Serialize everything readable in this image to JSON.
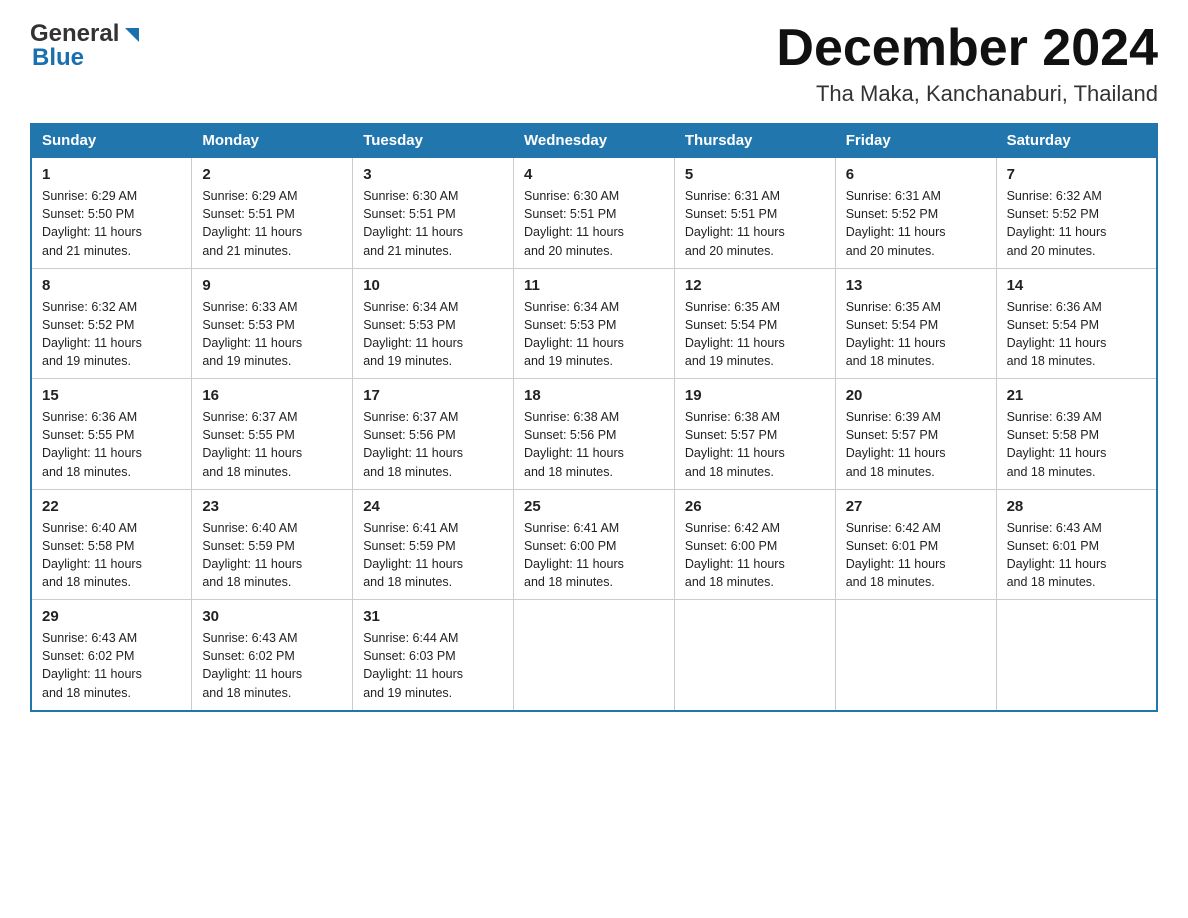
{
  "header": {
    "logo_general": "General",
    "logo_blue": "Blue",
    "main_title": "December 2024",
    "sub_title": "Tha Maka, Kanchanaburi, Thailand"
  },
  "days_of_week": [
    "Sunday",
    "Monday",
    "Tuesday",
    "Wednesday",
    "Thursday",
    "Friday",
    "Saturday"
  ],
  "weeks": [
    [
      {
        "day": "1",
        "sunrise": "6:29 AM",
        "sunset": "5:50 PM",
        "daylight": "11 hours and 21 minutes."
      },
      {
        "day": "2",
        "sunrise": "6:29 AM",
        "sunset": "5:51 PM",
        "daylight": "11 hours and 21 minutes."
      },
      {
        "day": "3",
        "sunrise": "6:30 AM",
        "sunset": "5:51 PM",
        "daylight": "11 hours and 21 minutes."
      },
      {
        "day": "4",
        "sunrise": "6:30 AM",
        "sunset": "5:51 PM",
        "daylight": "11 hours and 20 minutes."
      },
      {
        "day": "5",
        "sunrise": "6:31 AM",
        "sunset": "5:51 PM",
        "daylight": "11 hours and 20 minutes."
      },
      {
        "day": "6",
        "sunrise": "6:31 AM",
        "sunset": "5:52 PM",
        "daylight": "11 hours and 20 minutes."
      },
      {
        "day": "7",
        "sunrise": "6:32 AM",
        "sunset": "5:52 PM",
        "daylight": "11 hours and 20 minutes."
      }
    ],
    [
      {
        "day": "8",
        "sunrise": "6:32 AM",
        "sunset": "5:52 PM",
        "daylight": "11 hours and 19 minutes."
      },
      {
        "day": "9",
        "sunrise": "6:33 AM",
        "sunset": "5:53 PM",
        "daylight": "11 hours and 19 minutes."
      },
      {
        "day": "10",
        "sunrise": "6:34 AM",
        "sunset": "5:53 PM",
        "daylight": "11 hours and 19 minutes."
      },
      {
        "day": "11",
        "sunrise": "6:34 AM",
        "sunset": "5:53 PM",
        "daylight": "11 hours and 19 minutes."
      },
      {
        "day": "12",
        "sunrise": "6:35 AM",
        "sunset": "5:54 PM",
        "daylight": "11 hours and 19 minutes."
      },
      {
        "day": "13",
        "sunrise": "6:35 AM",
        "sunset": "5:54 PM",
        "daylight": "11 hours and 18 minutes."
      },
      {
        "day": "14",
        "sunrise": "6:36 AM",
        "sunset": "5:54 PM",
        "daylight": "11 hours and 18 minutes."
      }
    ],
    [
      {
        "day": "15",
        "sunrise": "6:36 AM",
        "sunset": "5:55 PM",
        "daylight": "11 hours and 18 minutes."
      },
      {
        "day": "16",
        "sunrise": "6:37 AM",
        "sunset": "5:55 PM",
        "daylight": "11 hours and 18 minutes."
      },
      {
        "day": "17",
        "sunrise": "6:37 AM",
        "sunset": "5:56 PM",
        "daylight": "11 hours and 18 minutes."
      },
      {
        "day": "18",
        "sunrise": "6:38 AM",
        "sunset": "5:56 PM",
        "daylight": "11 hours and 18 minutes."
      },
      {
        "day": "19",
        "sunrise": "6:38 AM",
        "sunset": "5:57 PM",
        "daylight": "11 hours and 18 minutes."
      },
      {
        "day": "20",
        "sunrise": "6:39 AM",
        "sunset": "5:57 PM",
        "daylight": "11 hours and 18 minutes."
      },
      {
        "day": "21",
        "sunrise": "6:39 AM",
        "sunset": "5:58 PM",
        "daylight": "11 hours and 18 minutes."
      }
    ],
    [
      {
        "day": "22",
        "sunrise": "6:40 AM",
        "sunset": "5:58 PM",
        "daylight": "11 hours and 18 minutes."
      },
      {
        "day": "23",
        "sunrise": "6:40 AM",
        "sunset": "5:59 PM",
        "daylight": "11 hours and 18 minutes."
      },
      {
        "day": "24",
        "sunrise": "6:41 AM",
        "sunset": "5:59 PM",
        "daylight": "11 hours and 18 minutes."
      },
      {
        "day": "25",
        "sunrise": "6:41 AM",
        "sunset": "6:00 PM",
        "daylight": "11 hours and 18 minutes."
      },
      {
        "day": "26",
        "sunrise": "6:42 AM",
        "sunset": "6:00 PM",
        "daylight": "11 hours and 18 minutes."
      },
      {
        "day": "27",
        "sunrise": "6:42 AM",
        "sunset": "6:01 PM",
        "daylight": "11 hours and 18 minutes."
      },
      {
        "day": "28",
        "sunrise": "6:43 AM",
        "sunset": "6:01 PM",
        "daylight": "11 hours and 18 minutes."
      }
    ],
    [
      {
        "day": "29",
        "sunrise": "6:43 AM",
        "sunset": "6:02 PM",
        "daylight": "11 hours and 18 minutes."
      },
      {
        "day": "30",
        "sunrise": "6:43 AM",
        "sunset": "6:02 PM",
        "daylight": "11 hours and 18 minutes."
      },
      {
        "day": "31",
        "sunrise": "6:44 AM",
        "sunset": "6:03 PM",
        "daylight": "11 hours and 19 minutes."
      },
      null,
      null,
      null,
      null
    ]
  ],
  "labels": {
    "sunrise": "Sunrise:",
    "sunset": "Sunset:",
    "daylight": "Daylight:"
  }
}
